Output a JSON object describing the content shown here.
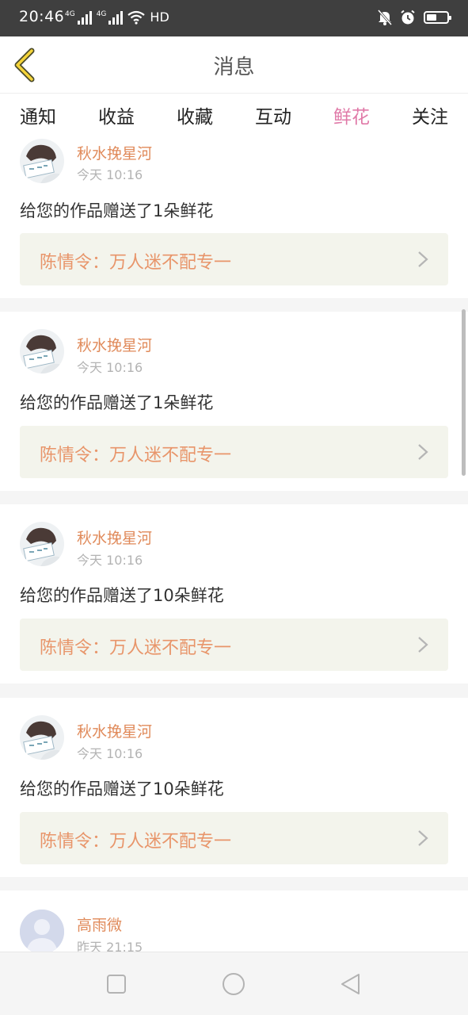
{
  "status_bar": {
    "time": "20:46",
    "net1": "4G",
    "net2": "4G",
    "hd": "HD",
    "battery_level": 0.5
  },
  "header": {
    "title": "消息"
  },
  "tabs": [
    {
      "label": "通知",
      "active": false
    },
    {
      "label": "收益",
      "active": false
    },
    {
      "label": "收藏",
      "active": false
    },
    {
      "label": "互动",
      "active": false
    },
    {
      "label": "鲜花",
      "active": true
    },
    {
      "label": "关注",
      "active": false
    }
  ],
  "messages": [
    {
      "user": "秋水挽星河",
      "time": "今天 10:16",
      "text": "给您的作品赠送了1朵鲜花",
      "work": "陈情令：万人迷不配专一"
    },
    {
      "user": "秋水挽星河",
      "time": "今天 10:16",
      "text": "给您的作品赠送了1朵鲜花",
      "work": "陈情令：万人迷不配专一"
    },
    {
      "user": "秋水挽星河",
      "time": "今天 10:16",
      "text": "给您的作品赠送了10朵鲜花",
      "work": "陈情令：万人迷不配专一"
    },
    {
      "user": "秋水挽星河",
      "time": "今天 10:16",
      "text": "给您的作品赠送了10朵鲜花",
      "work": "陈情令：万人迷不配专一"
    },
    {
      "user": "高雨微",
      "time": "昨天 21:15"
    }
  ],
  "colors": {
    "accent_pink": "#e07aa8",
    "username_orange": "#e08a5a",
    "work_bg": "#f3f4ec"
  }
}
